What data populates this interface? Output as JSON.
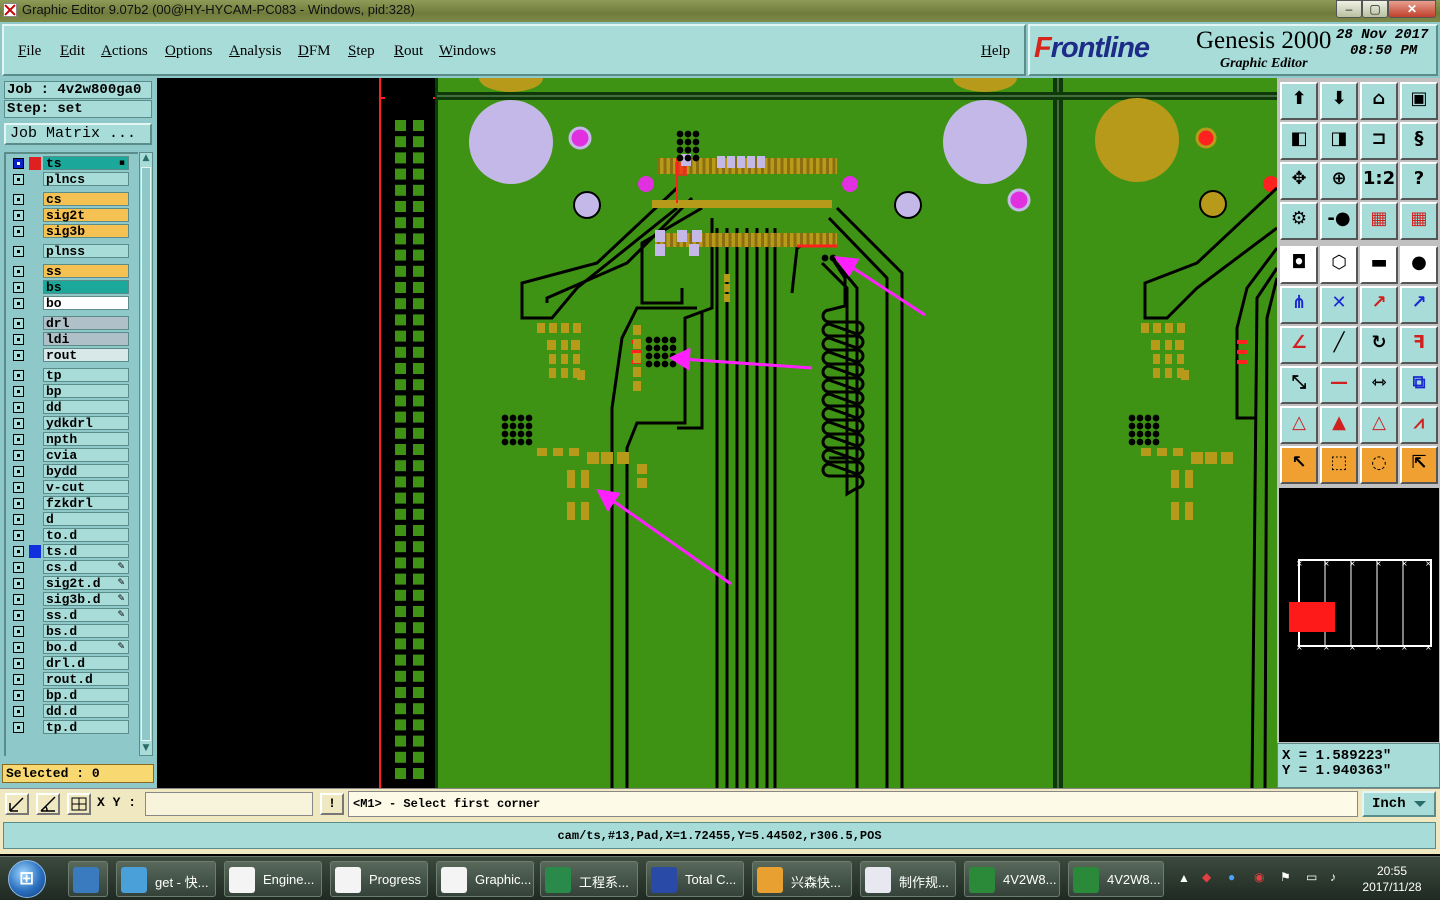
{
  "window": {
    "title": "Graphic Editor 9.07b2 (00@HY-HYCAM-PC083 - Windows, pid:328)",
    "controls": [
      "–",
      "▢",
      "✕"
    ]
  },
  "menu": {
    "items": [
      "File",
      "Edit",
      "Actions",
      "Options",
      "Analysis",
      "DFM",
      "Step",
      "Rout",
      "Windows"
    ],
    "help": "Help"
  },
  "brand": {
    "logo_first": "F",
    "logo_rest": "rontline",
    "product": "Genesis 2000",
    "subtitle": "Graphic Editor",
    "date": "28 Nov 2017",
    "time": "08:50 PM"
  },
  "job": {
    "job_line": "Job : 4v2w800ga0",
    "step_line": "Step: set",
    "matrix_button": "Job Matrix ..."
  },
  "layers": [
    {
      "name": "ts",
      "color": "#1ba89a",
      "swatch": "#e02020",
      "active": true,
      "editable": true
    },
    {
      "name": "plncs",
      "color": "#a8dcd8",
      "swatch": "",
      "active": false
    },
    {
      "name": "cs",
      "color": "#f5c152",
      "swatch": "",
      "active": false
    },
    {
      "name": "sig2t",
      "color": "#f5c152",
      "swatch": "",
      "active": false
    },
    {
      "name": "sig3b",
      "color": "#f5c152",
      "swatch": "",
      "active": false
    },
    {
      "name": "plnss",
      "color": "#a8dcd8",
      "swatch": "",
      "active": false
    },
    {
      "name": "ss",
      "color": "#f5c152",
      "swatch": "",
      "active": false
    },
    {
      "name": "bs",
      "color": "#1ba89a",
      "swatch": "",
      "active": false
    },
    {
      "name": "bo",
      "color": "#ffffff",
      "swatch": "",
      "active": false
    },
    {
      "name": "drl",
      "color": "#b0c0c8",
      "swatch": "",
      "active": false
    },
    {
      "name": "ldi",
      "color": "#b0c0c8",
      "swatch": "",
      "active": false
    },
    {
      "name": "rout",
      "color": "#d8e8e8",
      "swatch": "",
      "active": false
    },
    {
      "name": "tp",
      "color": "#a8dcd8",
      "swatch": "",
      "active": false
    },
    {
      "name": "bp",
      "color": "#a8dcd8",
      "swatch": "",
      "active": false
    },
    {
      "name": "dd",
      "color": "#a8dcd8",
      "swatch": "",
      "active": false
    },
    {
      "name": "ydkdrl",
      "color": "#a8dcd8",
      "swatch": "",
      "active": false
    },
    {
      "name": "npth",
      "color": "#a8dcd8",
      "swatch": "",
      "active": false
    },
    {
      "name": "cvia",
      "color": "#a8dcd8",
      "swatch": "",
      "active": false
    },
    {
      "name": "bydd",
      "color": "#a8dcd8",
      "swatch": "",
      "active": false
    },
    {
      "name": "v-cut",
      "color": "#a8dcd8",
      "swatch": "",
      "active": false
    },
    {
      "name": "fzkdrl",
      "color": "#a8dcd8",
      "swatch": "",
      "active": false
    },
    {
      "name": "d",
      "color": "#a8dcd8",
      "swatch": "",
      "active": false
    },
    {
      "name": "to.d",
      "color": "#a8dcd8",
      "swatch": "",
      "active": false
    },
    {
      "name": "ts.d",
      "color": "#a8dcd8",
      "swatch": "#1030e0",
      "active": false
    },
    {
      "name": "cs.d",
      "color": "#a8dcd8",
      "swatch": "",
      "active": false,
      "editable": true
    },
    {
      "name": "sig2t.d",
      "color": "#a8dcd8",
      "swatch": "",
      "active": false,
      "editable": true
    },
    {
      "name": "sig3b.d",
      "color": "#a8dcd8",
      "swatch": "",
      "active": false,
      "editable": true
    },
    {
      "name": "ss.d",
      "color": "#a8dcd8",
      "swatch": "",
      "active": false,
      "editable": true
    },
    {
      "name": "bs.d",
      "color": "#a8dcd8",
      "swatch": "",
      "active": false
    },
    {
      "name": "bo.d",
      "color": "#a8dcd8",
      "swatch": "",
      "active": false,
      "editable": true
    },
    {
      "name": "drl.d",
      "color": "#a8dcd8",
      "swatch": "",
      "active": false
    },
    {
      "name": "rout.d",
      "color": "#a8dcd8",
      "swatch": "",
      "active": false
    },
    {
      "name": "bp.d",
      "color": "#a8dcd8",
      "swatch": "",
      "active": false
    },
    {
      "name": "dd.d",
      "color": "#a8dcd8",
      "swatch": "",
      "active": false
    },
    {
      "name": "tp.d",
      "color": "#a8dcd8",
      "swatch": "",
      "active": false
    }
  ],
  "selected_text": "Selected : 0",
  "coordinates": {
    "x": "X = 1.589223\"",
    "y": "Y = 1.940363\""
  },
  "command": {
    "xy_label": "X Y :",
    "xy_value": "",
    "prompt": "<M1> - Select first corner",
    "units": "Inch"
  },
  "status": "cam/ts,#13,Pad,X=1.72455,Y=5.44502,r306.5,POS",
  "taskbar": {
    "tasks": [
      {
        "label": "",
        "color": "#3a7abf"
      },
      {
        "label": "get - 快...",
        "color": "#4aa0d8"
      },
      {
        "label": "Engine...",
        "color": "#f4f4f4"
      },
      {
        "label": "Progress",
        "color": "#f4f4f4"
      },
      {
        "label": "Graphic...",
        "color": "#f4f4f4"
      },
      {
        "label": "工程系...",
        "color": "#2a8a4a"
      },
      {
        "label": "Total C...",
        "color": "#2a4aa8"
      },
      {
        "label": "兴森快...",
        "color": "#e8a030"
      },
      {
        "label": "制作规...",
        "color": "#e8e8f0"
      },
      {
        "label": "4V2W8...",
        "color": "#2a8a3a"
      },
      {
        "label": "4V2W8...",
        "color": "#2a8a3a"
      }
    ],
    "clock_time": "20:55",
    "clock_date": "2017/11/28"
  },
  "colors": {
    "board": "#3f9314",
    "copper": "#b89a1a",
    "trace_outline": "#000000",
    "pad_lavender": "#c4b8e8",
    "via_magenta": "#e030e0",
    "arrow": "#ff20ff",
    "highlight_red": "#ff2020"
  }
}
